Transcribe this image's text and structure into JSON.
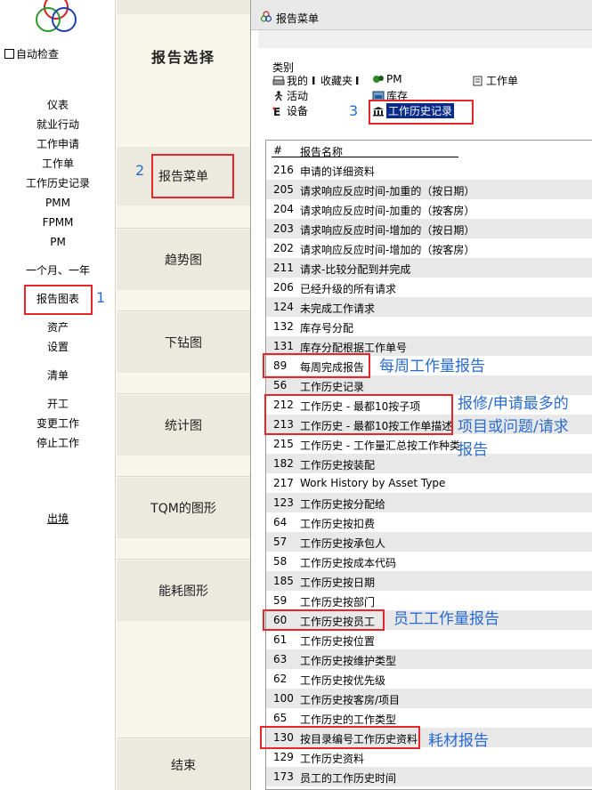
{
  "sidebar": {
    "autocheck_label": "自动检查",
    "items": [
      "仪表",
      "就业行动",
      "工作申请",
      "工作单",
      "工作历史记录",
      "PMM",
      "FPMM",
      "PM"
    ],
    "period_label": "一个月、一年",
    "report_chart": "报告图表",
    "items2": [
      "资产",
      "设置"
    ],
    "list_label": "清单",
    "items3": [
      "开工",
      "变更工作",
      "停止工作"
    ],
    "logout": "出境"
  },
  "middle": {
    "report_select": "报告选择",
    "report_menu": "报告菜单",
    "trend": "趋势图",
    "drilldown": "下钻图",
    "statistics": "统计图",
    "tqm": "TQM的图形",
    "energy": "能耗图形",
    "end": "结束"
  },
  "dialog": {
    "title": "报告菜单",
    "category_label": "类别",
    "categories": {
      "mine": "我的",
      "favorites": "收藏夹",
      "pm": "PM",
      "workorder": "工作单",
      "activity": "活动",
      "inventory": "库存",
      "equipment": "设备",
      "history": "工作历史记录"
    },
    "list_header": {
      "num": "#",
      "name": "报告名称"
    },
    "rows": [
      {
        "num": "216",
        "name": "申请的详细资料"
      },
      {
        "num": "205",
        "name": "请求响应反应时间-加重的（按日期）"
      },
      {
        "num": "204",
        "name": "请求响应反应时间-加重的（按客房）"
      },
      {
        "num": "203",
        "name": "请求响应反应时间-增加的（按日期）"
      },
      {
        "num": "202",
        "name": "请求响应反应时间-增加的（按客房）"
      },
      {
        "num": "211",
        "name": "请求-比较分配到并完成"
      },
      {
        "num": "206",
        "name": "已经升级的所有请求"
      },
      {
        "num": "124",
        "name": "未完成工作请求"
      },
      {
        "num": "132",
        "name": "库存号分配"
      },
      {
        "num": "131",
        "name": "库存分配根据工作单号"
      },
      {
        "num": "89",
        "name": "每周完成报告"
      },
      {
        "num": "56",
        "name": "工作历史记录"
      },
      {
        "num": "212",
        "name": "工作历史 - 最都10按子项"
      },
      {
        "num": "213",
        "name": "工作历史 - 最都10按工作单描述"
      },
      {
        "num": "215",
        "name": "工作历史 - 工作量汇总按工作种类"
      },
      {
        "num": "182",
        "name": "工作历史按装配"
      },
      {
        "num": "217",
        "name": "Work History by Asset Type"
      },
      {
        "num": "123",
        "name": "工作历史按分配给"
      },
      {
        "num": "64",
        "name": "工作历史按扣费"
      },
      {
        "num": "57",
        "name": "工作历史按承包人"
      },
      {
        "num": "58",
        "name": "工作历史按成本代码"
      },
      {
        "num": "185",
        "name": "工作历史按日期"
      },
      {
        "num": "59",
        "name": "工作历史按部门"
      },
      {
        "num": "60",
        "name": "工作历史按员工"
      },
      {
        "num": "61",
        "name": "工作历史按位置"
      },
      {
        "num": "63",
        "name": "工作历史按维护类型"
      },
      {
        "num": "62",
        "name": "工作历史按优先级"
      },
      {
        "num": "100",
        "name": "工作历史按客房/项目"
      },
      {
        "num": "65",
        "name": "工作历史的工作类型"
      },
      {
        "num": "130",
        "name": "按目录编号工作历史资料"
      },
      {
        "num": "129",
        "name": "工作历史资料"
      },
      {
        "num": "173",
        "name": "员工的工作历史时间"
      }
    ]
  },
  "annotations": {
    "n1": "1",
    "n2": "2",
    "n3": "3",
    "weekly": "每周工作量报告",
    "repair_line1": "报修/申请最多的",
    "repair_line2": "项目或问题/请求",
    "repair_line3": "报告",
    "employee": "员工工作量报告",
    "consumable": "耗材报告"
  },
  "colors": {
    "annotation_blue": "#2a6bd0",
    "highlight_red": "#e8262a",
    "selected_category": "#0a2a8a"
  }
}
